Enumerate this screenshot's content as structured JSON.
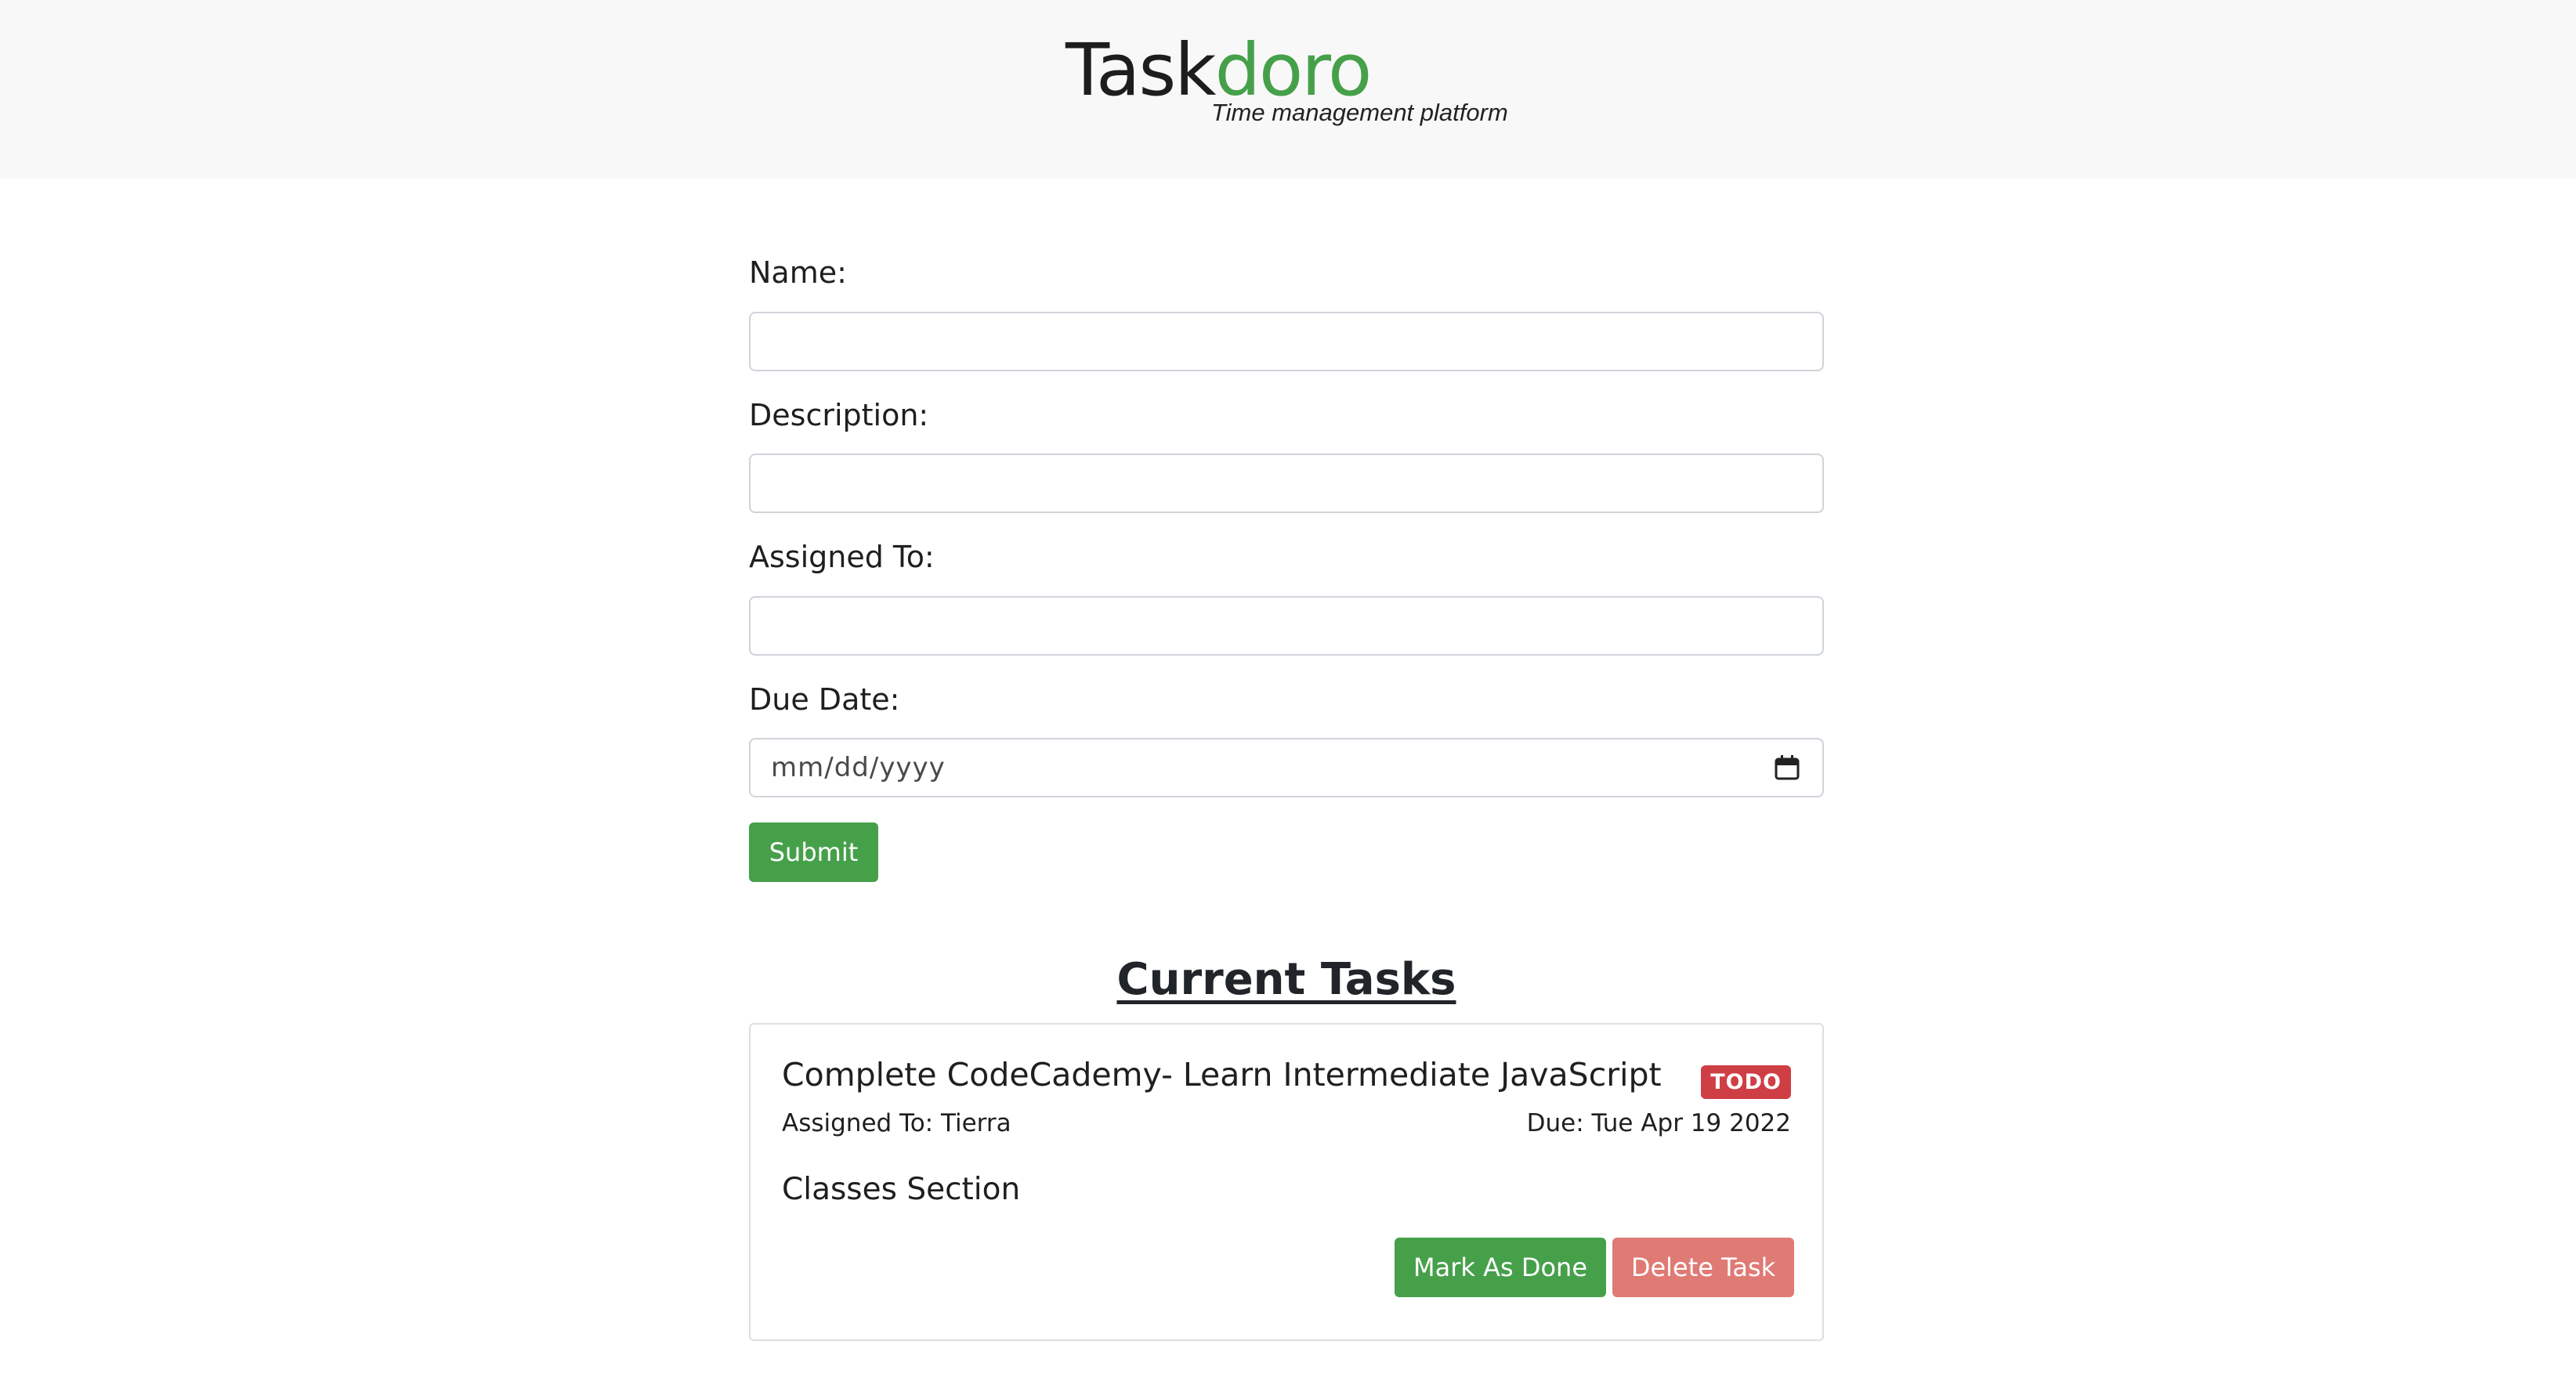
{
  "header": {
    "brand_part1": "Task",
    "brand_part2": "doro",
    "tagline": "Time management platform"
  },
  "form": {
    "name_label": "Name:",
    "name_value": "",
    "description_label": "Description:",
    "description_value": "",
    "assigned_label": "Assigned To:",
    "assigned_value": "",
    "due_label": "Due Date:",
    "due_placeholder": "mm/dd/yyyy",
    "submit_label": "Submit"
  },
  "tasks": {
    "section_title": "Current Tasks",
    "items": [
      {
        "title": "Complete CodeCademy- Learn Intermediate JavaScript",
        "status": "TODO",
        "assigned": "Assigned To: Tierra",
        "due": "Due: Tue Apr 19 2022",
        "description": "Classes Section",
        "mark_done_label": "Mark As Done",
        "delete_label": "Delete Task"
      }
    ]
  },
  "colors": {
    "accent_green": "#46a04a",
    "badge_red": "#cf3e44",
    "delete_red": "#e07a75"
  },
  "icons": {
    "date_picker": "calendar-icon"
  }
}
